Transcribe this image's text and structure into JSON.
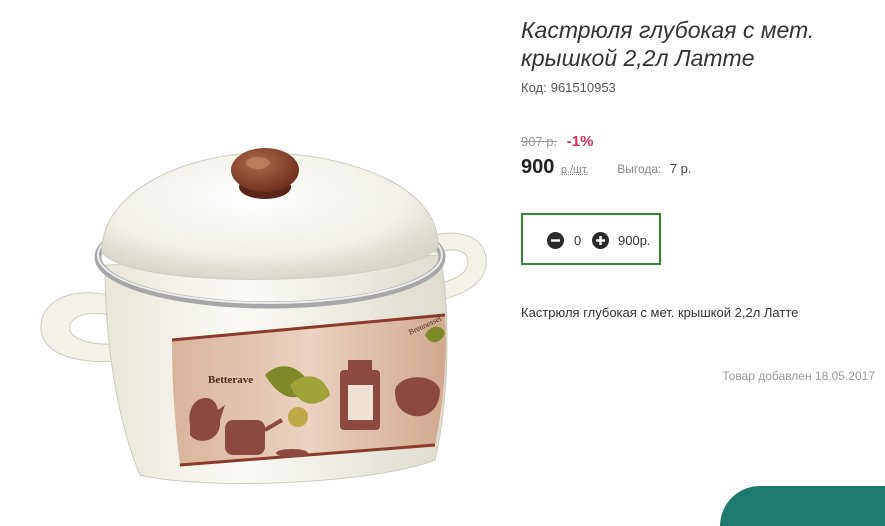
{
  "product": {
    "title": "Кастрюля глубокая с мет. крышкой 2,2л Латте",
    "code_label": "Код:",
    "code_value": "961510953",
    "old_price": "907 р.",
    "discount": "-1%",
    "price": "900",
    "price_unit": "р./шт.",
    "savings_label": "Выгода:",
    "savings_value": "7 р.",
    "description": "Кастрюля глубокая с мет. крышкой 2,2л Латте",
    "added_date": "Товар добавлен 18.05.2017"
  },
  "cart": {
    "quantity": "0",
    "sum": "900р."
  },
  "image": {
    "labels": [
      "Betterave",
      "Brennessel"
    ]
  },
  "colors": {
    "accent_green": "#2e8b2e",
    "discount_red": "#d9304f",
    "brand_teal": "#1e7a6c"
  },
  "icons": {
    "minus": "minus-circle-icon",
    "plus": "plus-circle-icon"
  }
}
